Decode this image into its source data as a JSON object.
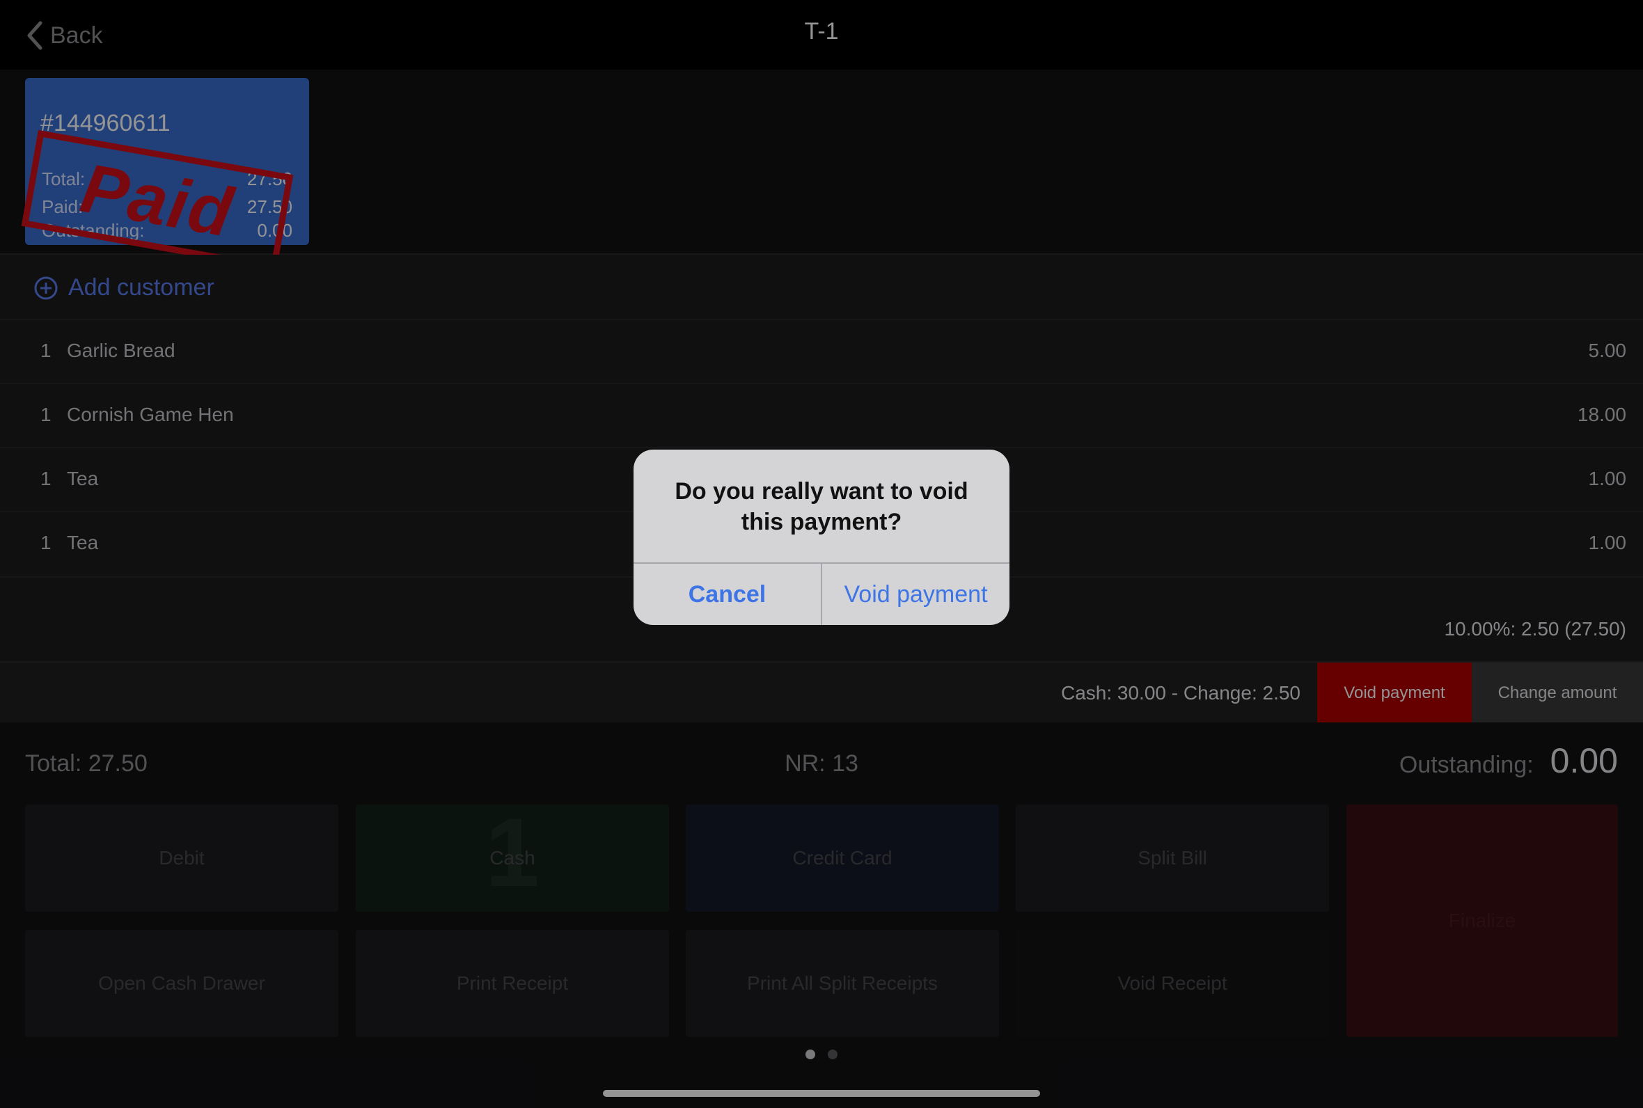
{
  "header": {
    "back_label": "Back",
    "title": "T-1"
  },
  "ticket": {
    "id": "#144960611",
    "total_label": "Total:",
    "total_value": "27.50",
    "paid_label": "Paid:",
    "paid_value": "27.50",
    "outstanding_label": "Outstanding:",
    "outstanding_value": "0.00",
    "stamp": "Paid"
  },
  "order": {
    "add_customer_label": "Add customer",
    "items": [
      {
        "qty": "1",
        "name": "Garlic Bread",
        "price": "5.00"
      },
      {
        "qty": "1",
        "name": "Cornish Game Hen",
        "price": "18.00"
      },
      {
        "qty": "1",
        "name": "Tea",
        "price": "1.00"
      },
      {
        "qty": "1",
        "name": "Tea",
        "price": "1.00"
      }
    ],
    "tax_line": "10.00%: 2.50 (27.50)"
  },
  "payment": {
    "info": "Cash: 30.00  - Change: 2.50",
    "void_label": "Void payment",
    "change_label": "Change amount"
  },
  "summary": {
    "total_label": "Total:",
    "total_value": "27.50",
    "nr": "NR: 13",
    "outstanding_label": "Outstanding:",
    "outstanding_value": "0.00"
  },
  "actions": {
    "debit": "Debit",
    "cash": "Cash",
    "cash_badge": "1",
    "credit_card": "Credit Card",
    "split_bill": "Split Bill",
    "open_cash_drawer": "Open Cash Drawer",
    "print_receipt": "Print Receipt",
    "print_all_split": "Print All Split Receipts",
    "void_receipt": "Void Receipt",
    "finalize": "Finalize"
  },
  "dialog": {
    "message": "Do you really want to void this payment?",
    "cancel_label": "Cancel",
    "confirm_label": "Void payment"
  },
  "colors": {
    "accent_blue": "#3d74e6",
    "void_red": "#b00000",
    "ticket_blue": "#3a6fd0",
    "stamp_red": "#d0101a"
  }
}
